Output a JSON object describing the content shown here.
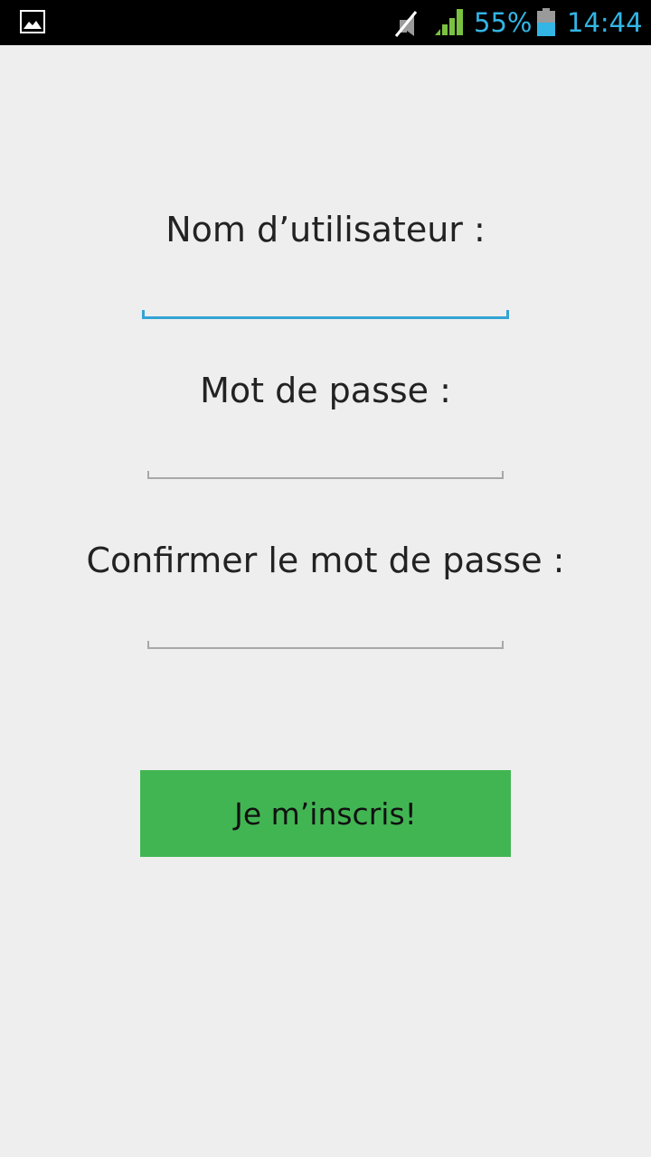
{
  "status_bar": {
    "battery_percent": "55%",
    "time": "14:44",
    "icons": [
      "gallery-icon",
      "mute-icon",
      "signal-icon",
      "battery-icon"
    ],
    "accent_color": "#33b5e5"
  },
  "form": {
    "username_label": "Nom d’utilisateur :",
    "username_value": "",
    "password_label": "Mot de passe :",
    "password_value": "",
    "confirm_label": "Confirmer le mot de passe :",
    "confirm_value": "",
    "submit_label": "Je m’inscris!",
    "submit_color": "#42b553",
    "focused_field_color": "#33a3d4"
  }
}
